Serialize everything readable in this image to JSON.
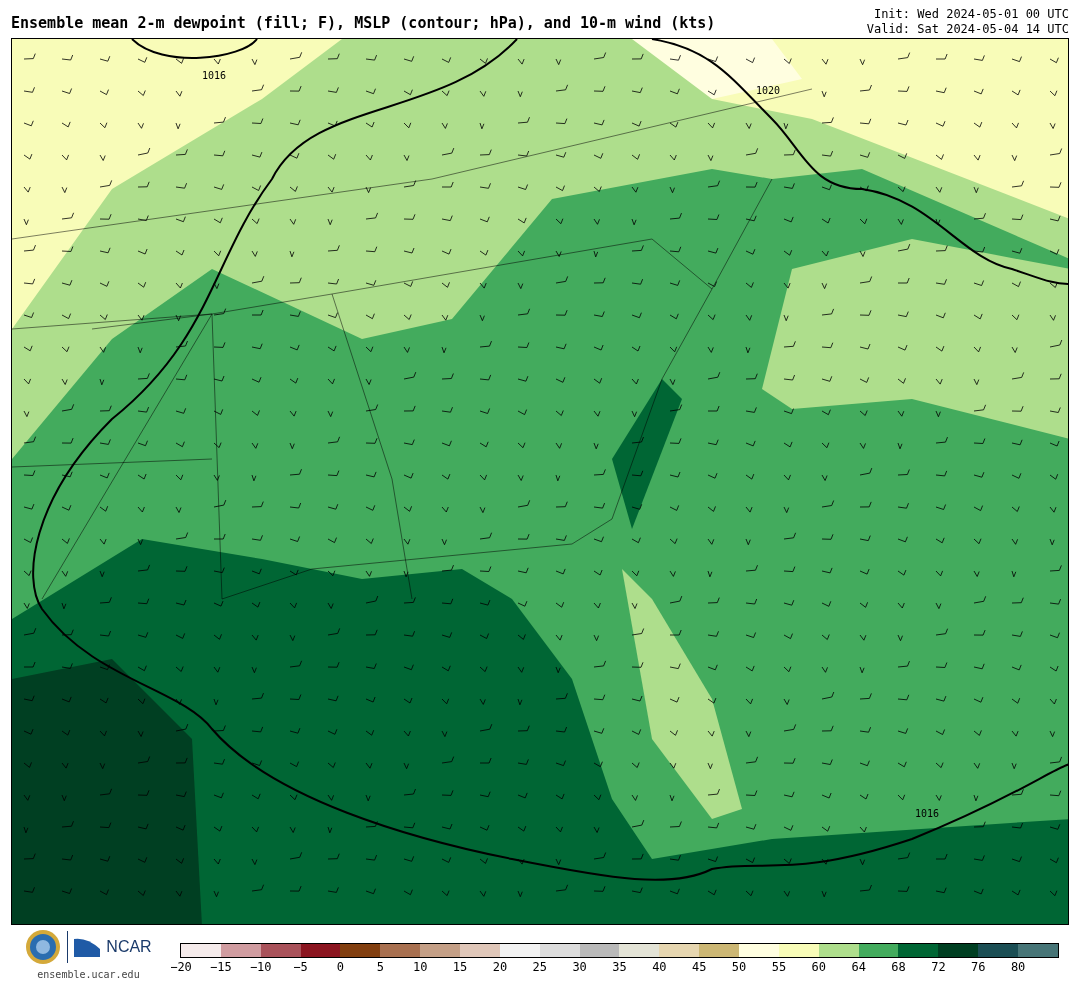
{
  "title": "Ensemble mean 2-m dewpoint (fill; F), MSLP (contour; hPa), and 10-m wind (kts)",
  "init": "Init: Wed 2024-05-01 00 UTC",
  "valid": "Valid: Sat 2024-05-04 14 UTC",
  "map": {
    "contour_labels": [
      "1016",
      "1020",
      "1016"
    ]
  },
  "footer": {
    "logo_text": "NCAR",
    "site": "ensemble.ucar.edu"
  },
  "colorbar": {
    "bins": [
      {
        "color": "#f5ebeb"
      },
      {
        "color": "#d09ca0"
      },
      {
        "color": "#a9525a"
      },
      {
        "color": "#8b1520"
      },
      {
        "color": "#823f10"
      },
      {
        "color": "#a87050"
      },
      {
        "color": "#c49f86"
      },
      {
        "color": "#e0c7b9"
      },
      {
        "color": "#f2f2f2"
      },
      {
        "color": "#dcdcdc"
      },
      {
        "color": "#b9b9b9"
      },
      {
        "color": "#e3e3d6"
      },
      {
        "color": "#e6d6b0"
      },
      {
        "color": "#ccb774"
      },
      {
        "color": "#fffee0"
      },
      {
        "color": "#f8fcb8"
      },
      {
        "color": "#aede8c"
      },
      {
        "color": "#43ab5d"
      },
      {
        "color": "#006634"
      },
      {
        "color": "#003f22"
      },
      {
        "color": "#1b4e54"
      },
      {
        "color": "#477577"
      }
    ],
    "ticks": [
      "−20",
      "−15",
      "−10",
      "−5",
      "0",
      "5",
      "10",
      "15",
      "20",
      "25",
      "30",
      "35",
      "40",
      "45",
      "50",
      "55",
      "60",
      "64",
      "68",
      "72",
      "76",
      "80"
    ]
  }
}
